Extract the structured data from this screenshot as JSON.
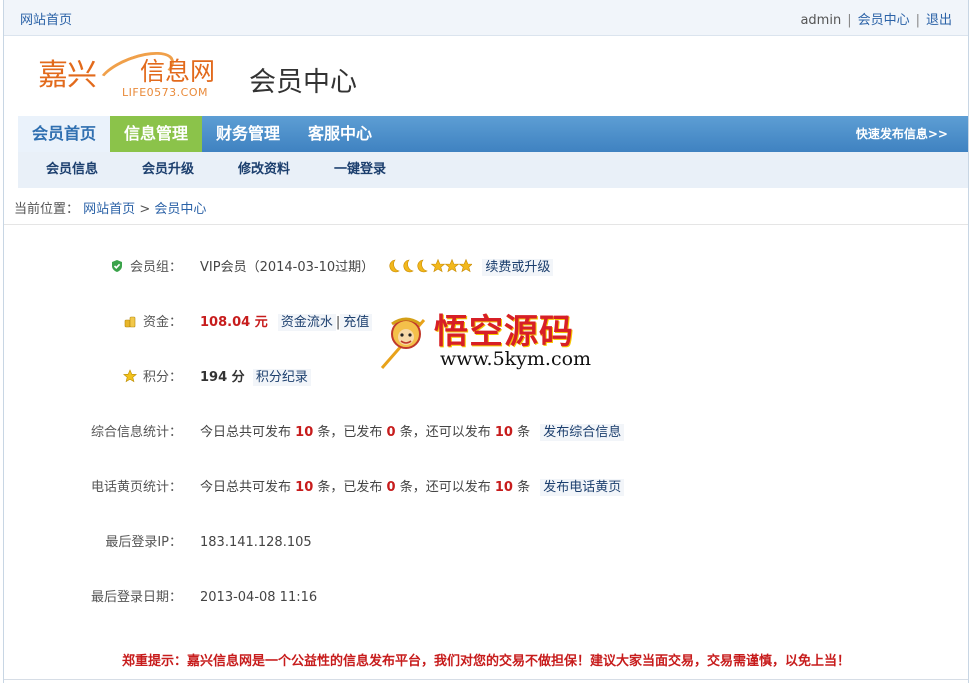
{
  "topbar": {
    "home": "网站首页",
    "username": "admin",
    "member_center": "会员中心",
    "logout": "退出",
    "sep": "|"
  },
  "header": {
    "logo_cn_1": "嘉兴",
    "logo_cn_2": "信息网",
    "logo_en": "LIFE0573.COM",
    "title": "会员中心"
  },
  "nav": {
    "tabs": [
      {
        "label": "会员首页"
      },
      {
        "label": "信息管理"
      },
      {
        "label": "财务管理"
      },
      {
        "label": "客服中心"
      }
    ],
    "quick_publish": "快速发布信息>>"
  },
  "subnav": {
    "items": [
      {
        "label": "会员信息"
      },
      {
        "label": "会员升级"
      },
      {
        "label": "修改资料"
      },
      {
        "label": "一键登录"
      }
    ]
  },
  "breadcrumb": {
    "prefix": "当前位置：",
    "home": "网站首页",
    "sep": ">",
    "current": "会员中心"
  },
  "info": {
    "group_label": "会员组：",
    "group_value": "VIP会员（2014-03-10过期）",
    "renew_link": "续费或升级",
    "funds_label": "资金：",
    "funds_value": "108.04 元",
    "funds_flow": "资金流水",
    "recharge": "充值",
    "link_sep": "|",
    "points_label": "积分：",
    "points_value": "194 分",
    "points_log": "积分纪录",
    "stats_info_label": "综合信息统计：",
    "stats_phone_label": "电话黄页统计：",
    "stats_text_1": "今日总共可发布",
    "stats_text_2": "条，已发布",
    "stats_text_3": "条，还可以发布",
    "stats_text_4": "条",
    "stats_info_total": "10",
    "stats_info_used": "0",
    "stats_info_left": "10",
    "stats_phone_total": "10",
    "stats_phone_used": "0",
    "stats_phone_left": "10",
    "publish_info": "发布综合信息",
    "publish_phone": "发布电话黄页",
    "ip_label": "最后登录IP：",
    "ip_value": "183.141.128.105",
    "date_label": "最后登录日期：",
    "date_value": "2013-04-08 11:16",
    "level_icons": {
      "moons": 3,
      "stars": 3
    }
  },
  "watermark": {
    "title": "悟空源码",
    "url": "www.5kym.com"
  },
  "notice": "郑重提示：嘉兴信息网是一个公益性的信息发布平台，我们对您的交易不做担保！建议大家当面交易，交易需谨慎，以免上当！",
  "colors": {
    "nav_blue": "#4a8fcb",
    "active_green": "#8bc34a",
    "link_blue": "#2b62a7",
    "alert_red": "#c71c1c",
    "logo_orange": "#e26a1c"
  }
}
